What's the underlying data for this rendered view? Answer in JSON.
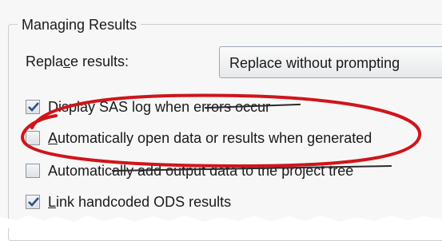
{
  "group": {
    "title": "Managing Results"
  },
  "replace": {
    "label_pre": "Repla",
    "label_mnemonic": "c",
    "label_post": "e results:",
    "selected": "Replace without prompting"
  },
  "options": [
    {
      "label": "Display SAS log when errors occur",
      "checked": true,
      "mnemonic_index": -1
    },
    {
      "label_pre": "",
      "label_mnemonic": "A",
      "label_post": "utomatically open data or results when generated",
      "checked": false
    },
    {
      "label": "Automatically add output data to the project tree",
      "checked": false
    },
    {
      "label_pre": "",
      "label_mnemonic": "L",
      "label_post": "ink handcoded ODS results",
      "checked": true
    }
  ],
  "colors": {
    "annotation_ellipse": "#d0141a",
    "checkmark": "#2b4f8f"
  }
}
